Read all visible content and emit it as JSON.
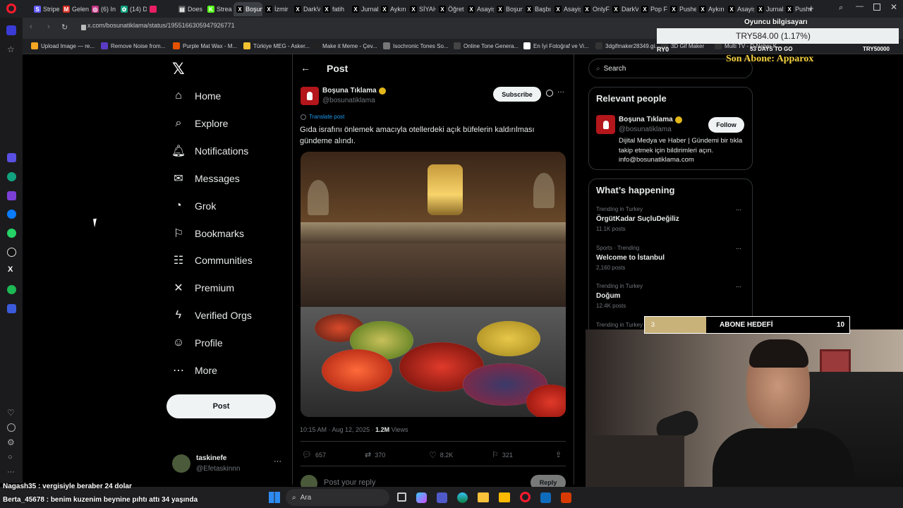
{
  "browser": {
    "tabs": [
      {
        "label": "Stripe",
        "color": "#635bff",
        "glyph": "S"
      },
      {
        "label": "Gelen",
        "color": "#d93025",
        "glyph": "M"
      },
      {
        "label": "(6) In",
        "color": "#c13584",
        "glyph": "◎"
      },
      {
        "label": "(14) D",
        "color": "#10a37f",
        "glyph": "✿"
      },
      {
        "label": "",
        "color": "#e91e63",
        "glyph": ""
      },
      {
        "label": "Does",
        "color": "#555",
        "glyph": "▤"
      },
      {
        "label": "Strea",
        "color": "#53fc18",
        "glyph": "K"
      },
      {
        "label": "Boşuna Tı",
        "color": "#000",
        "glyph": "X"
      },
      {
        "label": "İzmir",
        "color": "#000",
        "glyph": "X"
      },
      {
        "label": "DarkV",
        "color": "#000",
        "glyph": "X"
      },
      {
        "label": "fatih",
        "color": "#000",
        "glyph": "X"
      },
      {
        "label": "Jurnal",
        "color": "#000",
        "glyph": "X"
      },
      {
        "label": "Aykırı",
        "color": "#000",
        "glyph": "X"
      },
      {
        "label": "SİYAH",
        "color": "#000",
        "glyph": "X"
      },
      {
        "label": "Öğret",
        "color": "#000",
        "glyph": "X"
      },
      {
        "label": "Asayiş",
        "color": "#000",
        "glyph": "X"
      },
      {
        "label": "Boşun",
        "color": "#000",
        "glyph": "X"
      },
      {
        "label": "Başbı",
        "color": "#000",
        "glyph": "X"
      },
      {
        "label": "Asayiş",
        "color": "#000",
        "glyph": "X"
      },
      {
        "label": "OnlyF",
        "color": "#000",
        "glyph": "X"
      },
      {
        "label": "DarkV",
        "color": "#000",
        "glyph": "X"
      },
      {
        "label": "Pop F",
        "color": "#000",
        "glyph": "X"
      },
      {
        "label": "Pushe",
        "color": "#000",
        "glyph": "X"
      },
      {
        "label": "Aykırı",
        "color": "#000",
        "glyph": "X"
      },
      {
        "label": "Asayiş",
        "color": "#000",
        "glyph": "X"
      },
      {
        "label": "Jurnal",
        "color": "#000",
        "glyph": "X"
      },
      {
        "label": "Pushe",
        "color": "#000",
        "glyph": "X"
      }
    ],
    "url": "x.com/bosunatiklama/status/1955166305947926771",
    "bookmarks": [
      {
        "label": "Upload Image — re...",
        "color": "#f5a623"
      },
      {
        "label": "Remove Noise from...",
        "color": "#5b3cc4"
      },
      {
        "label": "Purple Mat Wax - M...",
        "color": "#e65100"
      },
      {
        "label": "Türkiye MEG - Asker...",
        "color": "#f2c230"
      },
      {
        "label": "Make it Meme - Çev...",
        "color": "#222"
      },
      {
        "label": "Isochronic Tones So...",
        "color": "#777"
      },
      {
        "label": "Online Tone Genera...",
        "color": "#444"
      },
      {
        "label": "En İyi Fotoğraf ve Vi...",
        "color": "#fff"
      },
      {
        "label": "3dgifmaker28349.gi...",
        "color": "#333"
      },
      {
        "label": "3D Gif Maker",
        "color": "#333"
      },
      {
        "label": "Multi TV - D-Naber K...",
        "color": "#333"
      }
    ]
  },
  "nav": {
    "items": [
      {
        "label": "Home",
        "icon": "home-icon"
      },
      {
        "label": "Explore",
        "icon": "search-icon"
      },
      {
        "label": "Notifications",
        "icon": "bell-icon"
      },
      {
        "label": "Messages",
        "icon": "mail-icon"
      },
      {
        "label": "Grok",
        "icon": "grok-icon"
      },
      {
        "label": "Bookmarks",
        "icon": "bookmark-icon"
      },
      {
        "label": "Communities",
        "icon": "people-icon"
      },
      {
        "label": "Premium",
        "icon": "x-icon"
      },
      {
        "label": "Verified Orgs",
        "icon": "lightning-icon"
      },
      {
        "label": "Profile",
        "icon": "person-icon"
      },
      {
        "label": "More",
        "icon": "more-icon"
      }
    ],
    "post_label": "Post",
    "account_name": "taskinefe",
    "account_handle": "@Efetaskinnn"
  },
  "post": {
    "header": "Post",
    "author_name": "Boşuna Tıklama",
    "author_handle": "@bosunatiklama",
    "subscribe": "Subscribe",
    "translate": "Translate post",
    "text": "Gıda israfını önlemek amacıyla otellerdeki açık büfelerin kaldırılması gündeme alındı.",
    "timestamp": "10:15 AM · Aug 12, 2025 · ",
    "views_count": "1.2M",
    "views_label": " Views",
    "replies": "657",
    "reposts": "370",
    "likes": "8.2K",
    "bookmarks": "321",
    "reply_placeholder": "Post your reply",
    "reply_button": "Reply"
  },
  "right": {
    "search_placeholder": "Search",
    "relevant_title": "Relevant people",
    "rp_name": "Boşuna Tıklama",
    "rp_handle": "@bosunatiklama",
    "follow": "Follow",
    "rp_bio": "Dijital Medya ve Haber | Gündemi bir tıkla takip etmek için bildirimleri açın. info@bosunatiklama.com",
    "happening_title": "What’s happening",
    "trends": [
      {
        "meta": "Trending in Turkey",
        "name": "ÖrgütKadar SuçluDeğiliz",
        "count": "11.1K posts"
      },
      {
        "meta": "Sports · Trending",
        "name": "Welcome to İstanbul",
        "count": "2,160 posts"
      },
      {
        "meta": "Trending in Turkey",
        "name": "Doğum",
        "count": "12.4K posts"
      },
      {
        "meta": "Trending in Turkey",
        "name": "",
        "count": ""
      }
    ]
  },
  "overlay": {
    "price_title": "Oyuncu bilgisayarı",
    "price": "TRY584.00 (1.17%)",
    "price_left": "RY0",
    "days": "53 DAYS TO GO",
    "price_right": "TRY50000",
    "last_sub": "Son Abone: Apparox",
    "goal_current": "3",
    "goal_label": "ABONE HEDEFİ",
    "goal_target": "10",
    "goal_fraction": 0.3,
    "chat": [
      {
        "user": "Nagash35",
        "msg": " : vergisiyle beraber 24 dolar"
      },
      {
        "user": "Berta_45678",
        "msg": " : benim kuzenim beynine pıhtı attı 34 yaşında"
      }
    ]
  },
  "taskbar": {
    "search": "Ara"
  }
}
